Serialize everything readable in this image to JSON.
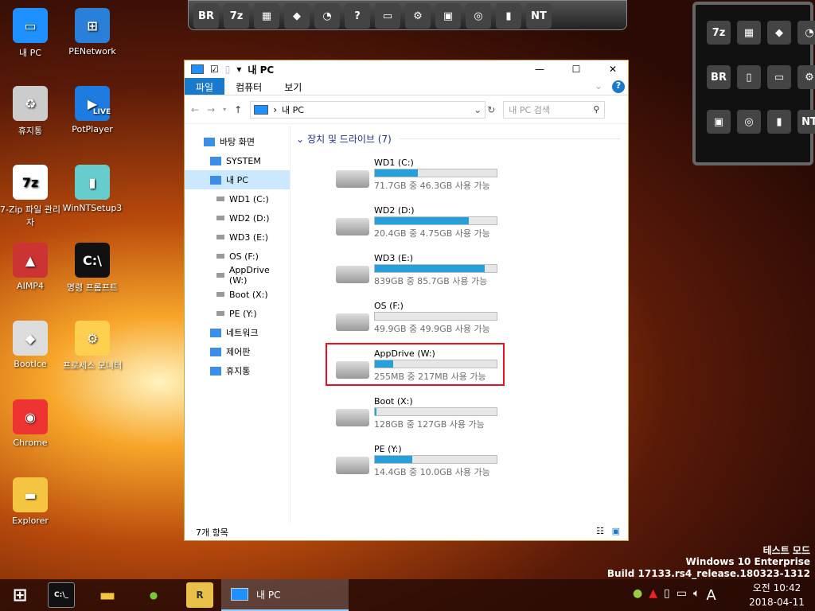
{
  "desktop": {
    "icons": [
      "내 PC",
      "PENetwork",
      "휴지통",
      "PotPlayer",
      "7-Zip 파일 관리자",
      "WinNTSetup3",
      "AIMP4",
      "명령 프롬프트",
      "BootIce",
      "프로세스 모니터",
      "Chrome",
      "Explorer"
    ],
    "potplayer_badge": "LIVE"
  },
  "toolbar": {
    "items": [
      "BR",
      "7z",
      "winrar",
      "bootice",
      "partition",
      "help",
      "monitor",
      "settings",
      "box",
      "cd",
      "winntsetup",
      "NT"
    ]
  },
  "panel": {
    "items": [
      "7z",
      "winrar",
      "bootice",
      "partition",
      "BR",
      "document",
      "monitor",
      "settings",
      "box",
      "cd",
      "winntsetup",
      "NT"
    ]
  },
  "window": {
    "title": "내 PC",
    "controls": {
      "minimize": "—",
      "maximize": "☐",
      "close": "✕"
    },
    "ribbon": {
      "tabs": [
        "파일",
        "컴퓨터",
        "보기"
      ],
      "active": "파일"
    },
    "address": {
      "path": "내 PC",
      "search_placeholder": "내 PC 검색"
    },
    "nav": [
      "바탕 화면",
      "SYSTEM",
      "내 PC",
      "WD1 (C:)",
      "WD2 (D:)",
      "WD3 (E:)",
      "OS (F:)",
      "AppDrive (W:)",
      "Boot (X:)",
      "PE (Y:)",
      "네트워크",
      "제어판",
      "휴지통"
    ],
    "section": "장치 및 드라이브 (7)",
    "drives": [
      {
        "name": "WD1 (C:)",
        "size": "71.7GB 중 46.3GB 사용 가능",
        "used": 0.35
      },
      {
        "name": "WD2 (D:)",
        "size": "20.4GB 중 4.75GB 사용 가능",
        "used": 0.77
      },
      {
        "name": "WD3 (E:)",
        "size": "839GB 중 85.7GB 사용 가능",
        "used": 0.9
      },
      {
        "name": "OS (F:)",
        "size": "49.9GB 중 49.9GB 사용 가능",
        "used": 0.0
      },
      {
        "name": "AppDrive (W:)",
        "size": "255MB 중 217MB 사용 가능",
        "used": 0.15,
        "highlighted": true
      },
      {
        "name": "Boot (X:)",
        "size": "128GB 중 127GB 사용 가능",
        "used": 0.01
      },
      {
        "name": "PE (Y:)",
        "size": "14.4GB 중 10.0GB 사용 가능",
        "used": 0.31
      }
    ],
    "status": "7개 항목"
  },
  "watermark": {
    "line1": "테스트 모드",
    "line2": "Windows 10 Enterprise",
    "line3": "Build 17133.rs4_release.180323-1312"
  },
  "taskbar": {
    "active_window": "내 PC",
    "time": "오전 10:42",
    "date": "2018-04-11",
    "ime": "A"
  },
  "colors": {
    "accent": "#1979ca",
    "bar": "#26a0da",
    "highlight": "#e81123"
  }
}
